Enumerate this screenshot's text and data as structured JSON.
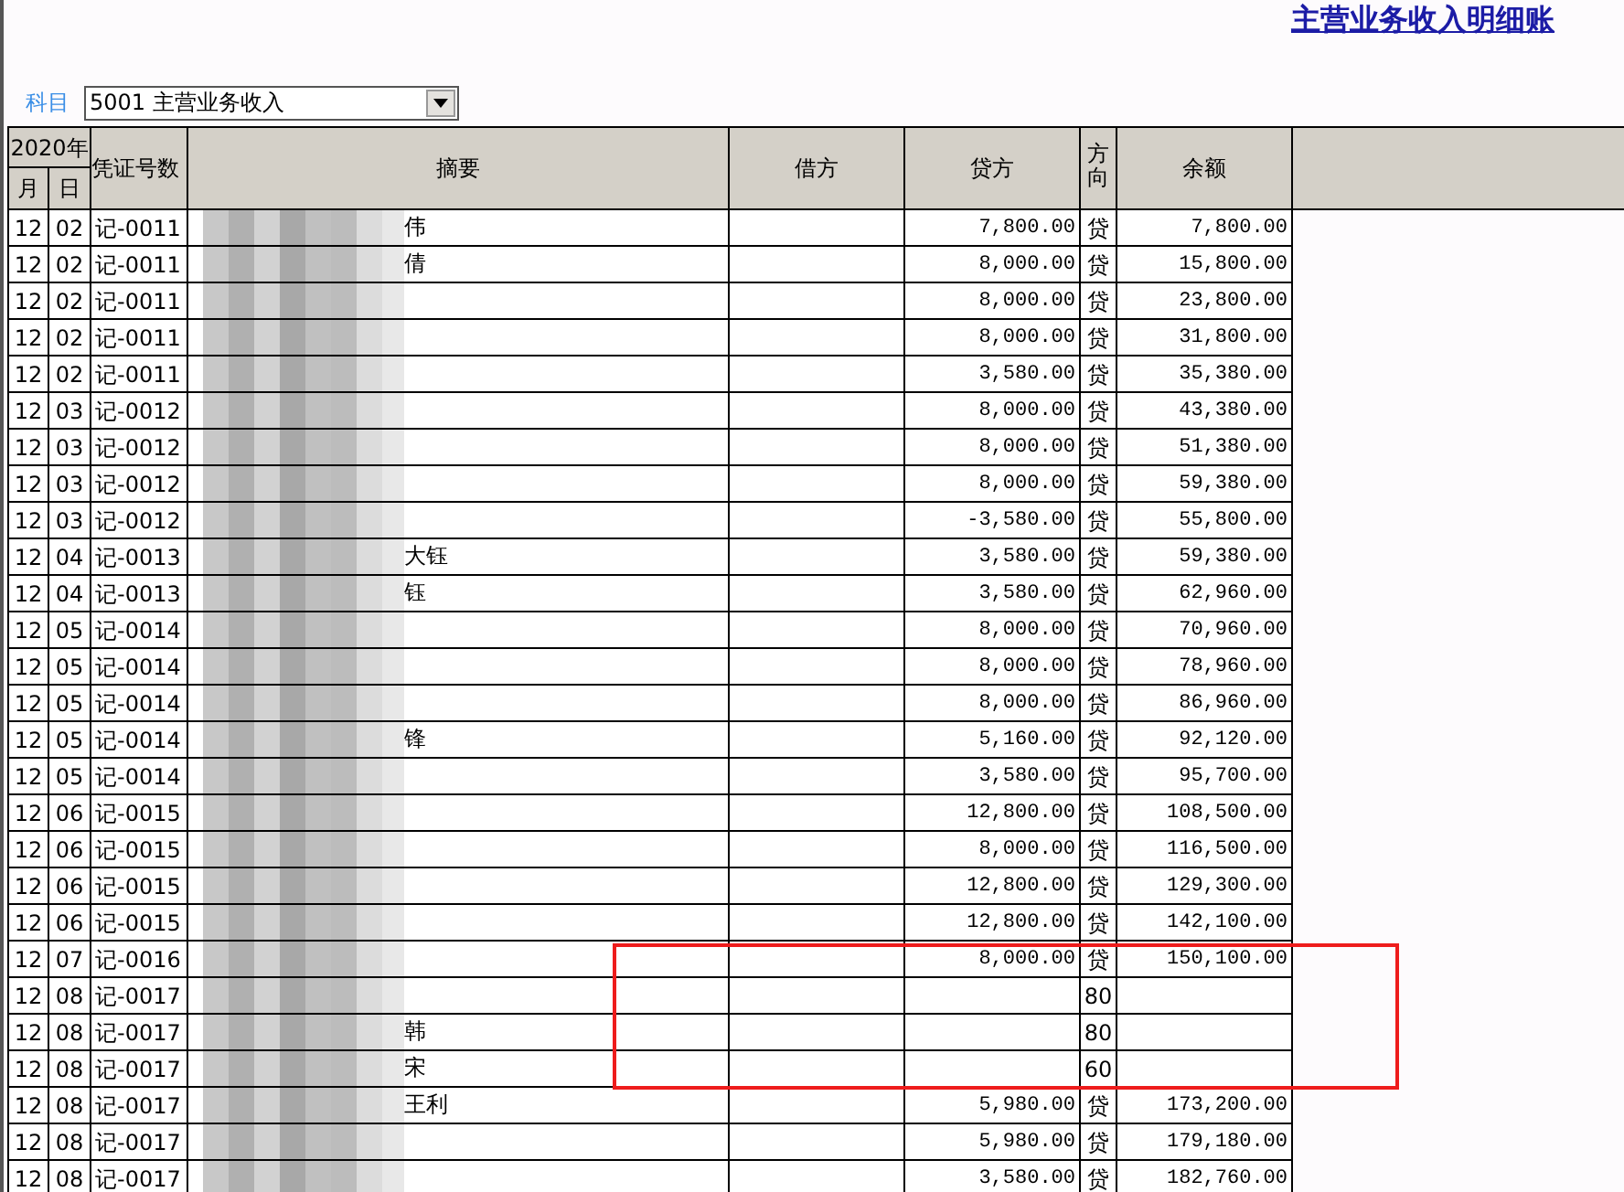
{
  "title": "主营业务收入明细账",
  "subject": {
    "label": "科目",
    "value": "5001 主营业务收入"
  },
  "table": {
    "year_header": "2020年",
    "columns": [
      "月",
      "日",
      "凭证号数",
      "摘要",
      "借方",
      "贷方",
      "方向",
      "余额"
    ],
    "rows": [
      {
        "month": "12",
        "day": "02",
        "voucher": "记-0011",
        "summary": "伟",
        "credit": "7,800.00",
        "direction": "贷",
        "balance": "7,800.00"
      },
      {
        "month": "12",
        "day": "02",
        "voucher": "记-0011",
        "summary": "倩",
        "credit": "8,000.00",
        "direction": "贷",
        "balance": "15,800.00"
      },
      {
        "month": "12",
        "day": "02",
        "voucher": "记-0011",
        "credit": "8,000.00",
        "direction": "贷",
        "balance": "23,800.00"
      },
      {
        "month": "12",
        "day": "02",
        "voucher": "记-0011",
        "credit": "8,000.00",
        "direction": "贷",
        "balance": "31,800.00"
      },
      {
        "month": "12",
        "day": "02",
        "voucher": "记-0011",
        "credit": "3,580.00",
        "direction": "贷",
        "balance": "35,380.00"
      },
      {
        "month": "12",
        "day": "03",
        "voucher": "记-0012",
        "credit": "8,000.00",
        "direction": "贷",
        "balance": "43,380.00"
      },
      {
        "month": "12",
        "day": "03",
        "voucher": "记-0012",
        "credit": "8,000.00",
        "direction": "贷",
        "balance": "51,380.00"
      },
      {
        "month": "12",
        "day": "03",
        "voucher": "记-0012",
        "credit": "8,000.00",
        "direction": "贷",
        "balance": "59,380.00"
      },
      {
        "month": "12",
        "day": "03",
        "voucher": "记-0012",
        "credit": "-3,580.00",
        "direction": "贷",
        "balance": "55,800.00"
      },
      {
        "month": "12",
        "day": "04",
        "voucher": "记-0013",
        "summary": "大钰",
        "credit": "3,580.00",
        "direction": "贷",
        "balance": "59,380.00"
      },
      {
        "month": "12",
        "day": "04",
        "voucher": "记-0013",
        "summary": "钰",
        "credit": "3,580.00",
        "direction": "贷",
        "balance": "62,960.00"
      },
      {
        "month": "12",
        "day": "05",
        "voucher": "记-0014",
        "credit": "8,000.00",
        "direction": "贷",
        "balance": "70,960.00"
      },
      {
        "month": "12",
        "day": "05",
        "voucher": "记-0014",
        "credit": "8,000.00",
        "direction": "贷",
        "balance": "78,960.00"
      },
      {
        "month": "12",
        "day": "05",
        "voucher": "记-0014",
        "credit": "8,000.00",
        "direction": "贷",
        "balance": "86,960.00"
      },
      {
        "month": "12",
        "day": "05",
        "voucher": "记-0014",
        "summary": "锋",
        "credit": "5,160.00",
        "direction": "贷",
        "balance": "92,120.00"
      },
      {
        "month": "12",
        "day": "05",
        "voucher": "记-0014",
        "credit": "3,580.00",
        "direction": "贷",
        "balance": "95,700.00"
      },
      {
        "month": "12",
        "day": "06",
        "voucher": "记-0015",
        "credit": "12,800.00",
        "direction": "贷",
        "balance": "108,500.00"
      },
      {
        "month": "12",
        "day": "06",
        "voucher": "记-0015",
        "credit": "8,000.00",
        "direction": "贷",
        "balance": "116,500.00"
      },
      {
        "month": "12",
        "day": "06",
        "voucher": "记-0015",
        "credit": "12,800.00",
        "direction": "贷",
        "balance": "129,300.00"
      },
      {
        "month": "12",
        "day": "06",
        "voucher": "记-0015",
        "credit": "12,800.00",
        "direction": "贷",
        "balance": "142,100.00"
      },
      {
        "month": "12",
        "day": "07",
        "voucher": "记-0016",
        "credit": "8,000.00",
        "direction": "贷",
        "balance": "150,100.00"
      },
      {
        "month": "12",
        "day": "08",
        "voucher": "记-0017",
        "direction": "80"
      },
      {
        "month": "12",
        "day": "08",
        "voucher": "记-0017",
        "summary": "韩",
        "direction": "80"
      },
      {
        "month": "12",
        "day": "08",
        "voucher": "记-0017",
        "summary": "宋",
        "direction": "60"
      },
      {
        "month": "12",
        "day": "08",
        "voucher": "记-0017",
        "summary": "王利",
        "credit": "5,980.00",
        "direction": "贷",
        "balance": "173,200.00"
      },
      {
        "month": "12",
        "day": "08",
        "voucher": "记-0017",
        "credit": "5,980.00",
        "direction": "贷",
        "balance": "179,180.00"
      },
      {
        "month": "12",
        "day": "08",
        "voucher": "记-0017",
        "credit": "3,580.00",
        "direction": "贷",
        "balance": "182,760.00"
      }
    ]
  },
  "annotation": {
    "kind": "rectangle"
  }
}
